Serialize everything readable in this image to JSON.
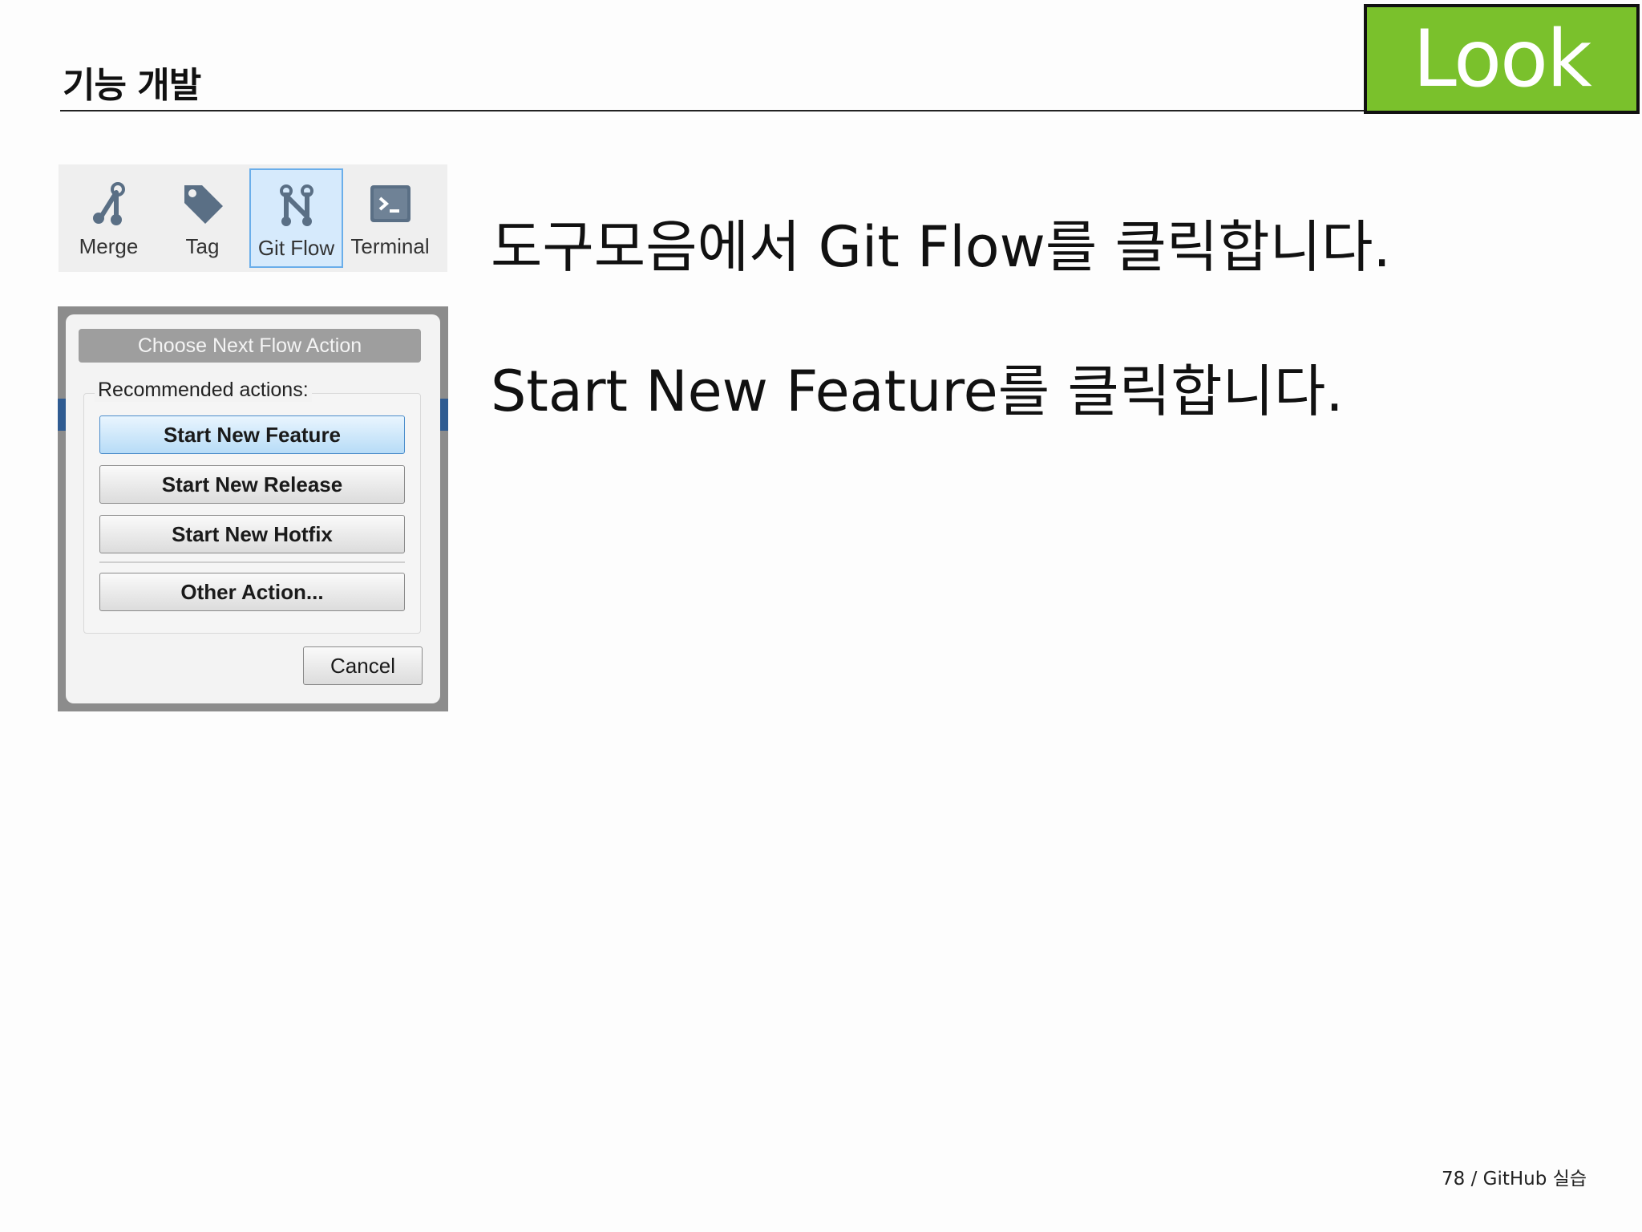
{
  "header": {
    "title": "기능 개발",
    "badge": "Look"
  },
  "toolbar": {
    "items": [
      {
        "label": "Merge",
        "icon": "merge-icon"
      },
      {
        "label": "Tag",
        "icon": "tag-icon"
      },
      {
        "label": "Git Flow",
        "icon": "git-flow-icon",
        "active": true
      },
      {
        "label": "Terminal",
        "icon": "terminal-icon"
      }
    ]
  },
  "dialog": {
    "caption": "Choose Next Flow Action",
    "group_label": "Recommended actions:",
    "buttons": [
      "Start New Feature",
      "Start New Release",
      "Start New Hotfix",
      "Other Action..."
    ],
    "cancel": "Cancel"
  },
  "instructions": [
    "도구모음에서  Git Flow를  클릭합니다.",
    "Start New Feature를  클릭합니다."
  ],
  "footer": "78 / GitHub 실습",
  "colors": {
    "badge": "#7ac12c",
    "active_tool": "#d6eafc",
    "focused_button": "#b7dcf7"
  }
}
